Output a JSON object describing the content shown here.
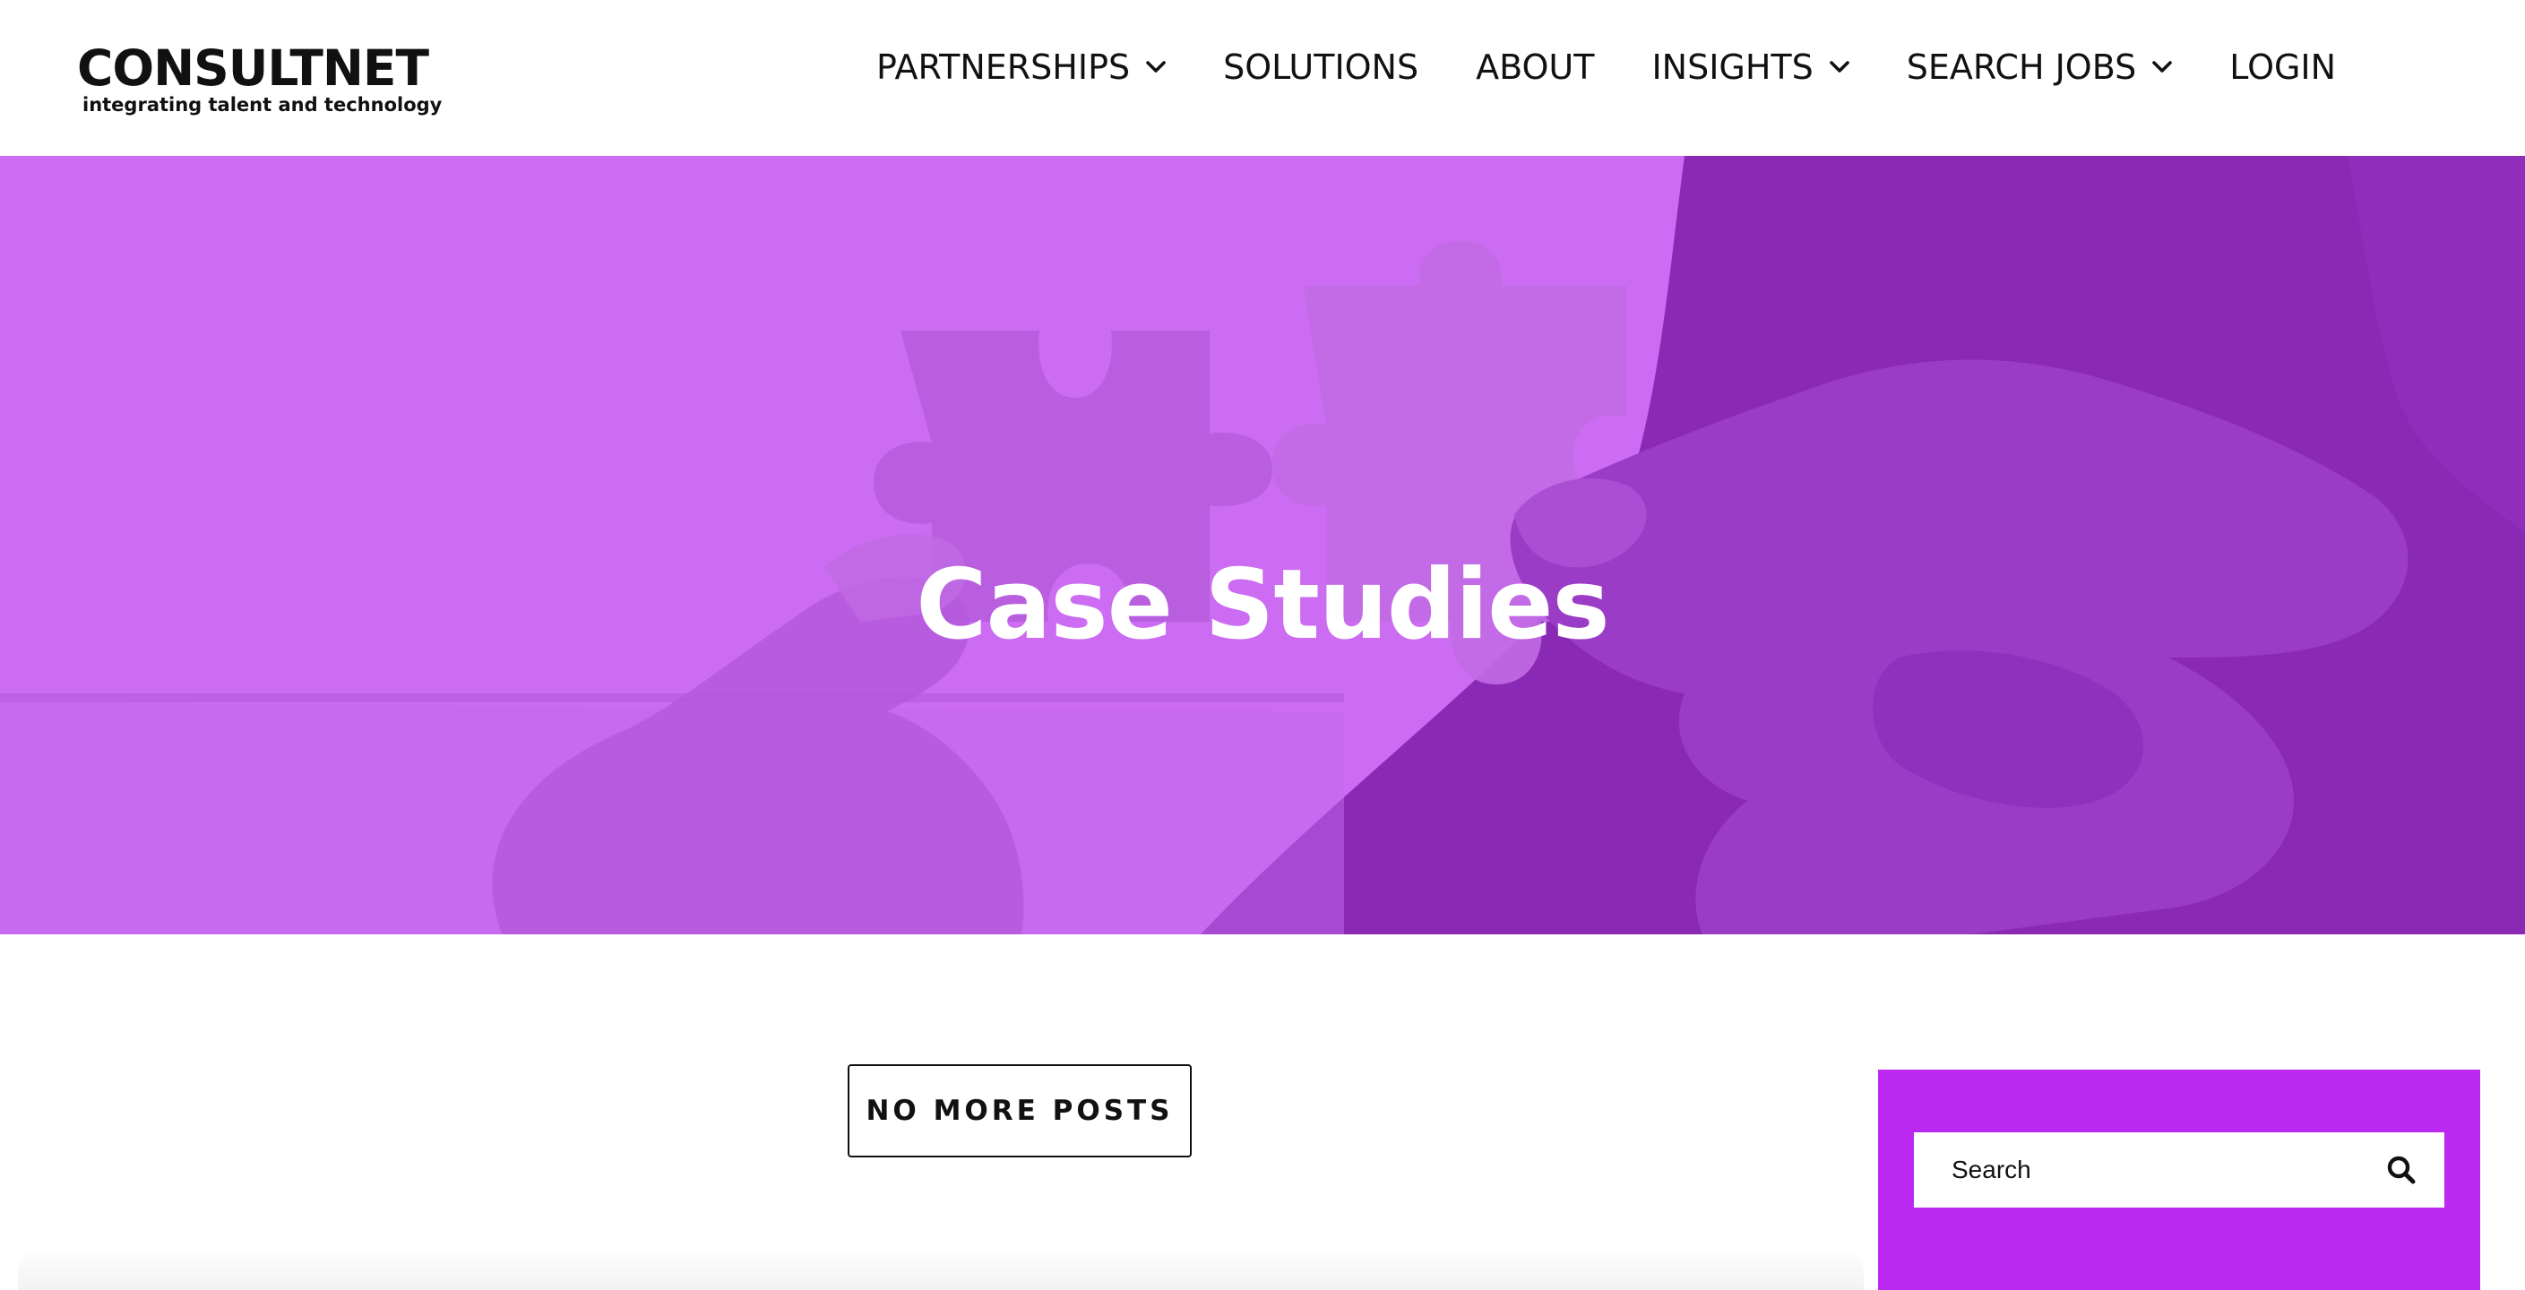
{
  "brand": {
    "name": "CONSULTNET",
    "tagline": "integrating talent and technology"
  },
  "nav": {
    "items": [
      {
        "label": "PARTNERSHIPS",
        "has_dropdown": true
      },
      {
        "label": "SOLUTIONS",
        "has_dropdown": false
      },
      {
        "label": "ABOUT",
        "has_dropdown": false
      },
      {
        "label": "INSIGHTS",
        "has_dropdown": true
      },
      {
        "label": "SEARCH JOBS",
        "has_dropdown": true
      },
      {
        "label": "LOGIN",
        "has_dropdown": false
      }
    ]
  },
  "hero": {
    "title": "Case Studies",
    "image": "hands-holding-puzzle-pieces",
    "overlay_color": "#cb6cf2"
  },
  "posts": {
    "no_more_label": "NO MORE POSTS"
  },
  "sidebar": {
    "background": "#bb29f0",
    "search": {
      "placeholder": "Search",
      "icon": "search-icon"
    }
  }
}
